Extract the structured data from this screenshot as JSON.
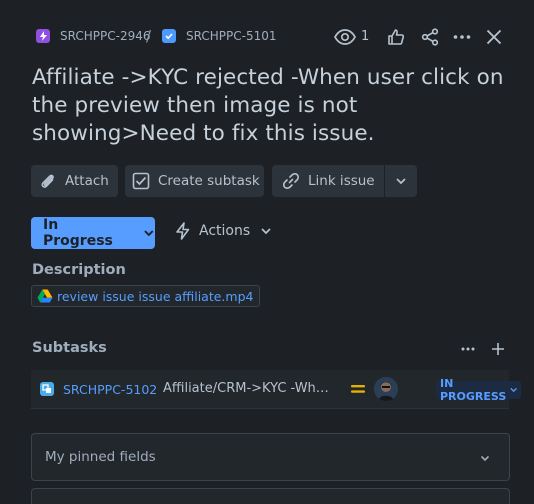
{
  "breadcrumb": {
    "parent_key": "SRCHPPC-2946",
    "separator": "/",
    "child_key": "SRCHPPC-5101"
  },
  "toolbar": {
    "watch_count": "1"
  },
  "issue": {
    "title": "Affiliate ->KYC rejected -When user click on the preview then image is not showing>Need to fix this issue."
  },
  "buttons": {
    "attach": "Attach",
    "create_subtask": "Create subtask",
    "link_issue": "Link issue"
  },
  "status": {
    "label": "In Progress",
    "actions_label": "Actions"
  },
  "description": {
    "heading": "Description",
    "attachment_name": "review issue issue affiliate.mp4"
  },
  "subtasks": {
    "heading": "Subtasks",
    "items": [
      {
        "key": "SRCHPPC-5102",
        "summary": "Affiliate/CRM->KYC -Wh…",
        "priority": "medium",
        "status": "IN PROGRESS"
      }
    ]
  },
  "pinned": {
    "label": "My pinned fields"
  },
  "colors": {
    "background": "#1d2125",
    "accent": "#579dff",
    "parent_type": "#904ee2",
    "priority_medium": "#e2b203"
  }
}
